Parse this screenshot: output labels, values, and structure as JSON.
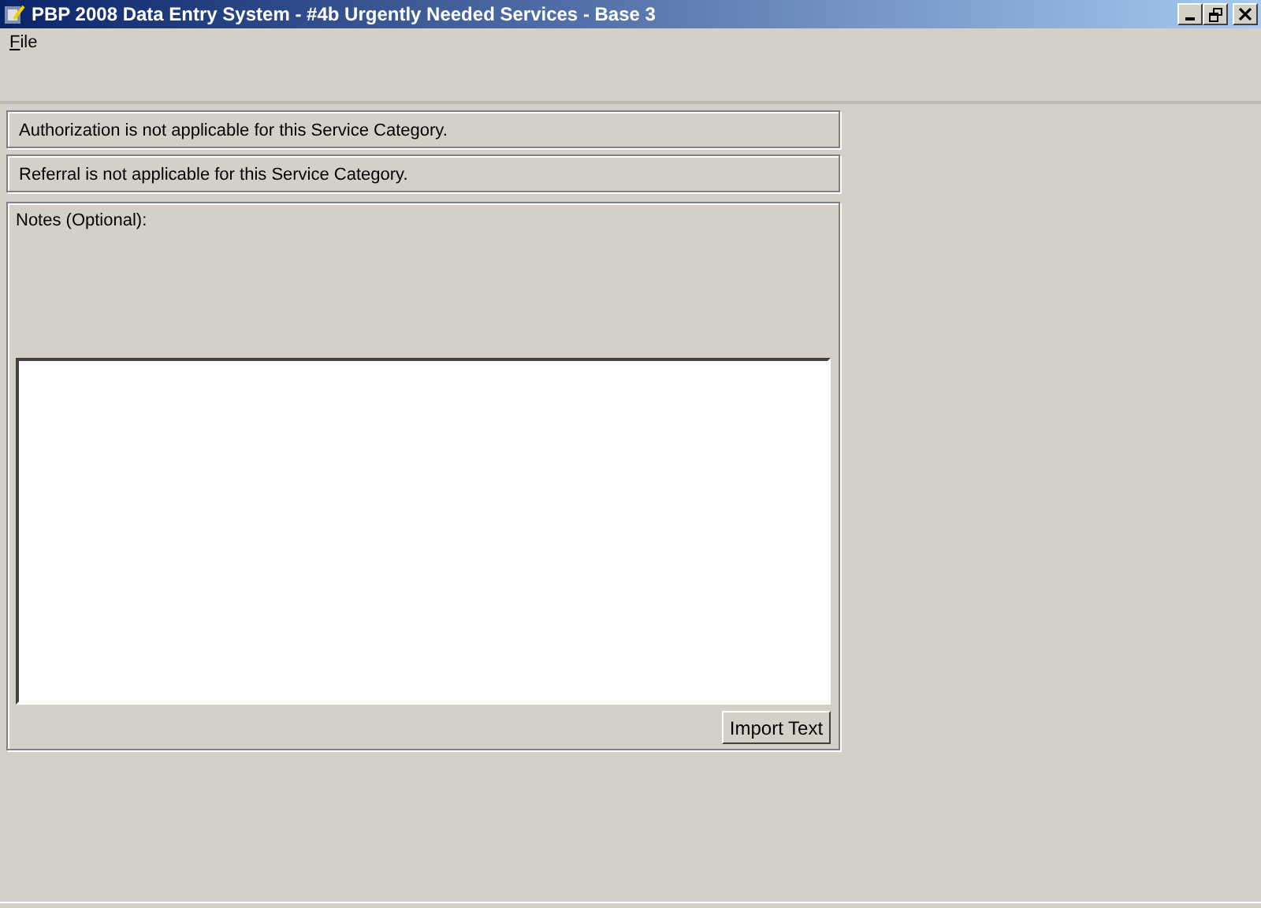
{
  "window": {
    "title": "PBP 2008 Data Entry System - #4b Urgently Needed Services - Base 3"
  },
  "menu": [
    "File"
  ],
  "notices": [
    "Authorization is not applicable for this Service Category.",
    "Referral is not applicable for this Service Category."
  ],
  "notes": {
    "label": "Notes (Optional):",
    "button": "Import Text"
  }
}
